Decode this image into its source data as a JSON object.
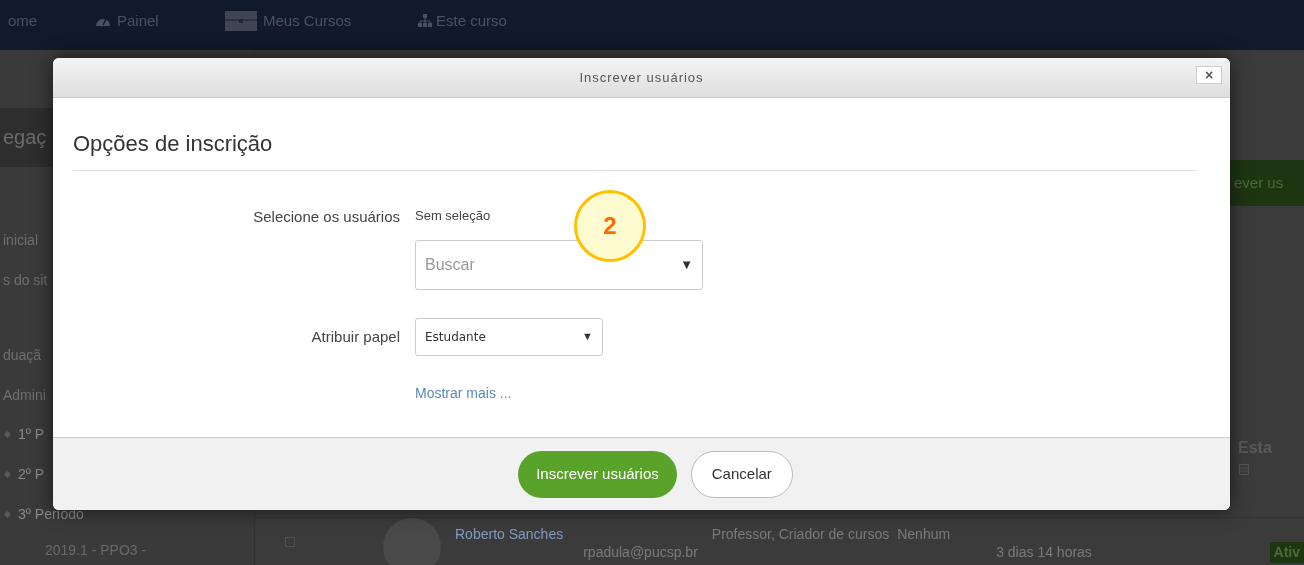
{
  "nav": {
    "items": [
      {
        "label": "ome",
        "kind": "none"
      },
      {
        "label": "Painel",
        "kind": "gauge"
      },
      {
        "label": "Meus Cursos",
        "kind": "case"
      },
      {
        "label": "Este curso",
        "kind": "sitemap"
      }
    ]
  },
  "sidebar": {
    "items": [
      {
        "label": "egaç",
        "kind": "heading"
      },
      {
        "label": "inicial",
        "kind": "link"
      },
      {
        "label": "s do sit",
        "kind": "link"
      },
      {
        "label": "duaçã",
        "kind": "link"
      },
      {
        "label": "Admini",
        "kind": "link"
      },
      {
        "label": "1º P",
        "kind": "bullet"
      },
      {
        "label": "2º P",
        "kind": "bullet"
      },
      {
        "label": "3º Período",
        "kind": "bullet"
      },
      {
        "label": "2019.1 - PPO3 -",
        "kind": "course"
      }
    ]
  },
  "right_strip": {
    "button": "ever us",
    "column_header": "Esta",
    "badge": "Ativ"
  },
  "table_row": {
    "name": "Roberto Sanches",
    "email": "rpadula@pucsp.br",
    "roles": "Professor, Criador de cursos",
    "groups": "Nenhum",
    "last_access": "3 dias 14 horas"
  },
  "dialog": {
    "title": "Inscrever usuários",
    "close": "×",
    "heading": "Opções de inscrição",
    "users": {
      "label": "Selecione os usuários",
      "selection": "Sem seleção",
      "placeholder": "Buscar",
      "arrow": "▼"
    },
    "role": {
      "label": "Atribuir papel",
      "value": "Estudante",
      "arrow": "▼"
    },
    "more_link": "Mostrar mais ...",
    "buttons": [
      {
        "label": "Inscrever usuários",
        "kind": "primary"
      },
      {
        "label": "Cancelar",
        "kind": "secondary"
      }
    ]
  },
  "annotation": {
    "label": "2"
  }
}
